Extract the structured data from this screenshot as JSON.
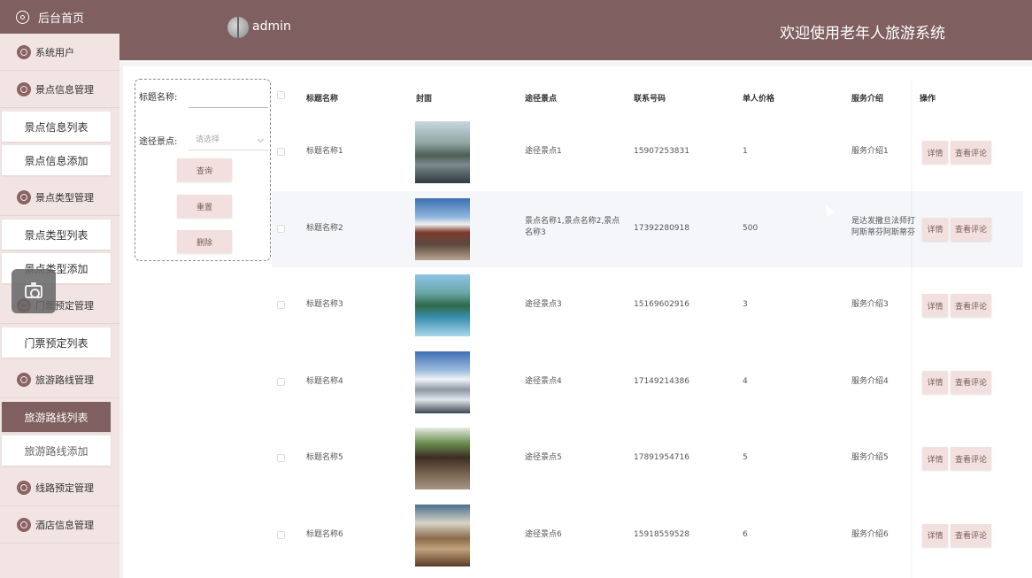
{
  "sidebar": {
    "home": "后台首页",
    "groups": [
      {
        "label": "系统用户",
        "items": []
      },
      {
        "label": "景点信息管理",
        "items": [
          "景点信息列表",
          "景点信息添加"
        ]
      },
      {
        "label": "景点类型管理",
        "items": [
          "景点类型列表",
          "景点类型添加"
        ]
      },
      {
        "label": "门票预定管理",
        "items": [
          "门票预定列表"
        ]
      },
      {
        "label": "旅游路线管理",
        "items": [
          "旅游路线列表",
          "旅游路线添加"
        ]
      },
      {
        "label": "线路预定管理",
        "items": []
      },
      {
        "label": "酒店信息管理",
        "items": []
      }
    ],
    "active_item": "旅游路线列表"
  },
  "header": {
    "user": "admin",
    "welcome": "欢迎使用老年人旅游系统"
  },
  "search": {
    "title_label": "标题名称:",
    "title_value": "",
    "spot_label": "途径景点:",
    "spot_placeholder": "请选择",
    "query_button": "查询",
    "reset_button": "重置",
    "delete_button": "删除"
  },
  "table": {
    "headers": [
      "标题名称",
      "封面",
      "途径景点",
      "联系号码",
      "单人价格",
      "服务介绍",
      "操作"
    ],
    "rows": [
      {
        "title": "标题名称1",
        "cover": "karst-river",
        "spots": "途径景点1",
        "phone": "15907253831",
        "price": "1",
        "intro": "服务介绍1"
      },
      {
        "title": "标题名称2",
        "cover": "pavilion",
        "spots": "景点名称1,景点名称2,景点名称3",
        "phone": "17392280918",
        "price": "500",
        "intro": "是达发撒旦法师打阿斯蒂芬阿斯蒂芬"
      },
      {
        "title": "标题名称3",
        "cover": "lake-mountain",
        "spots": "途径景点3",
        "phone": "15169602916",
        "price": "3",
        "intro": "服务介绍3"
      },
      {
        "title": "标题名称4",
        "cover": "snow-mountain",
        "spots": "途径景点4",
        "phone": "17149214386",
        "price": "4",
        "intro": "服务介绍4"
      },
      {
        "title": "标题名称5",
        "cover": "old-town",
        "spots": "途径景点5",
        "phone": "17891954716",
        "price": "5",
        "intro": "服务介绍5"
      },
      {
        "title": "标题名称6",
        "cover": "waterfall",
        "spots": "途径景点6",
        "phone": "15918559528",
        "price": "6",
        "intro": "服务介绍6"
      }
    ],
    "detail_button": "详情",
    "review_button": "查看评论"
  },
  "colors": {
    "brand": "#7f5f5f",
    "sidebar_bg": "#f2e4e3",
    "button_bg": "#f2e0de"
  }
}
